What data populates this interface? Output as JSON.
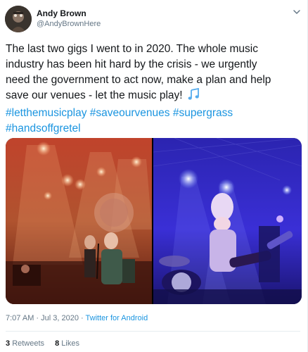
{
  "user": {
    "display_name": "Andy Brown",
    "handle": "@AndyBrownHere"
  },
  "icons": {
    "more": "chevron-down-icon",
    "emoji": "musical-notes-emoji"
  },
  "tweet": {
    "lines": [
      "The last two gigs I went to in 2020. The whole music",
      "industry has been hit hard by the crisis - we urgently",
      "need the government to act now, make a plan and help",
      "save our venues - let the music play!"
    ],
    "hashtags_line1": [
      "#letthemusicplay",
      "#saveourvenues",
      "#supergrass"
    ],
    "hashtags_line2": [
      "#handsoffgretel"
    ]
  },
  "meta": {
    "time": "7:07 AM",
    "sep1": " · ",
    "date": "Jul 3, 2020",
    "sep2": " · ",
    "source": "Twitter for Android"
  },
  "stats": {
    "retweets_count": "3",
    "retweets_label": "Retweets",
    "likes_count": "8",
    "likes_label": "Likes"
  },
  "colors": {
    "link": "#1b95e0",
    "text": "#14171a",
    "muted": "#657786",
    "border": "#e6ecf0"
  }
}
